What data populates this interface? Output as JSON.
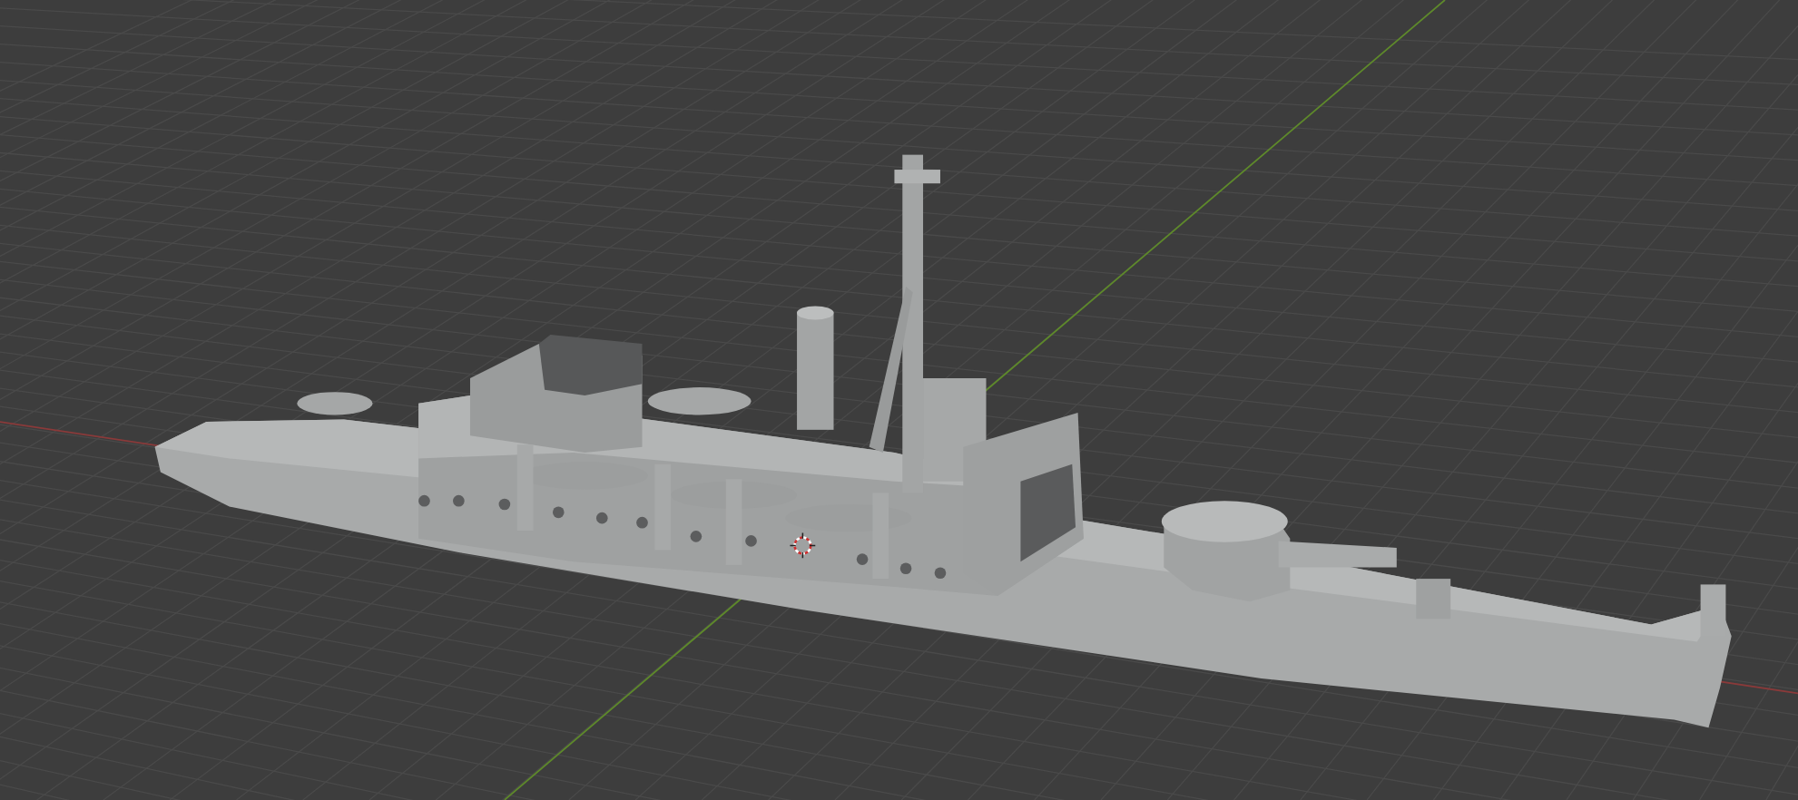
{
  "viewport": {
    "show_grid": true,
    "show_axes": true,
    "show_cursor": true
  }
}
